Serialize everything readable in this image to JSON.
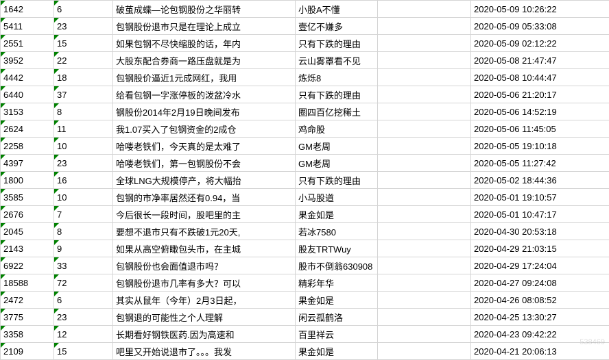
{
  "rows": [
    {
      "a": "1642",
      "b": "6",
      "c": "破茧成蝶—论包钢股份之华丽转",
      "d": "小股A不懂",
      "e": "",
      "f": "2020-05-09 10:26:22"
    },
    {
      "a": "5411",
      "b": "23",
      "c": "包钢股份退市只是在理论上成立",
      "d": "壹亿不嫌多",
      "e": "",
      "f": "2020-05-09 05:33:08"
    },
    {
      "a": "2551",
      "b": "15",
      "c": "如果包钢不尽快缩股的话，年内",
      "d": "只有下跌的理由",
      "e": "",
      "f": "2020-05-09 02:12:22"
    },
    {
      "a": "3952",
      "b": "22",
      "c": "大股东配合券商一路压盘就是为",
      "d": "云山雾罩看不见",
      "e": "",
      "f": "2020-05-08 21:47:47"
    },
    {
      "a": "4442",
      "b": "18",
      "c": "包钢股价逼近1元成网红，我用",
      "d": "炼烁8",
      "e": "",
      "f": "2020-05-08 10:44:47"
    },
    {
      "a": "6440",
      "b": "37",
      "c": "给看包钢一字涨停板的泼盆冷水",
      "d": "只有下跌的理由",
      "e": "",
      "f": "2020-05-06 21:20:17"
    },
    {
      "a": "3153",
      "b": "8",
      "c": "钢股份2014年2月19日晚间发布",
      "d": "圈四百亿挖稀土",
      "e": "",
      "f": "2020-05-06 14:52:19"
    },
    {
      "a": "2624",
      "b": "11",
      "c": "我1.07买入了包钢资金的2成仓",
      "d": "鸡命股",
      "e": "",
      "f": "2020-05-06 11:45:05"
    },
    {
      "a": "2258",
      "b": "10",
      "c": "哈喽老铁们，今天真的是太难了",
      "d": "GM老周",
      "e": "",
      "f": "2020-05-05 19:10:18"
    },
    {
      "a": "4397",
      "b": "23",
      "c": "哈喽老铁们，第一包钢股份不会",
      "d": "GM老周",
      "e": "",
      "f": "2020-05-05 11:27:42"
    },
    {
      "a": "1800",
      "b": "16",
      "c": "全球LNG大规模停产，将大幅抬",
      "d": "只有下跌的理由",
      "e": "",
      "f": "2020-05-02 18:44:36"
    },
    {
      "a": "3585",
      "b": "10",
      "c": "包钢的市净率居然还有0.94，当",
      "d": "小马股道",
      "e": "",
      "f": "2020-05-01 19:10:57"
    },
    {
      "a": "2676",
      "b": "7",
      "c": "今后很长一段时间，股吧里的主",
      "d": "果金如是",
      "e": "",
      "f": "2020-05-01 10:47:17"
    },
    {
      "a": "2045",
      "b": "8",
      "c": "要想不退市只有不跌破1元20天,",
      "d": "若冰7580",
      "e": "",
      "f": "2020-04-30 20:53:18"
    },
    {
      "a": "2143",
      "b": "9",
      "c": "如果从高空俯瞰包头市，在主城",
      "d": "股友TRTWuy",
      "e": "",
      "f": "2020-04-29 21:03:15"
    },
    {
      "a": "6922",
      "b": "33",
      "c": "包钢股份也会面值退市吗？",
      "d": "股市不倒翁630908",
      "e": "",
      "f": "2020-04-29 17:24:04"
    },
    {
      "a": "18588",
      "b": "72",
      "c": "包钢股份退市几率有多大？可以",
      "d": "精彩年华",
      "e": "",
      "f": "2020-04-27 09:24:08"
    },
    {
      "a": "2472",
      "b": "6",
      "c": "其实从鼠年（今年）2月3日起，",
      "d": "果金如是",
      "e": "",
      "f": "2020-04-26 08:08:52"
    },
    {
      "a": "3775",
      "b": "23",
      "c": "包钢退的可能性之个人理解",
      "d": "闲云孤鹤洛",
      "e": "",
      "f": "2020-04-25 13:30:27"
    },
    {
      "a": "3358",
      "b": "12",
      "c": "长期看好钢铁医药.因为高速和",
      "d": "百里祥云",
      "e": "",
      "f": "2020-04-23 09:42:22"
    },
    {
      "a": "2109",
      "b": "15",
      "c": "吧里又开始说退市了。。。我发",
      "d": "果金如是",
      "e": "",
      "f": "2020-04-21 20:06:13"
    }
  ],
  "watermark": "538469"
}
